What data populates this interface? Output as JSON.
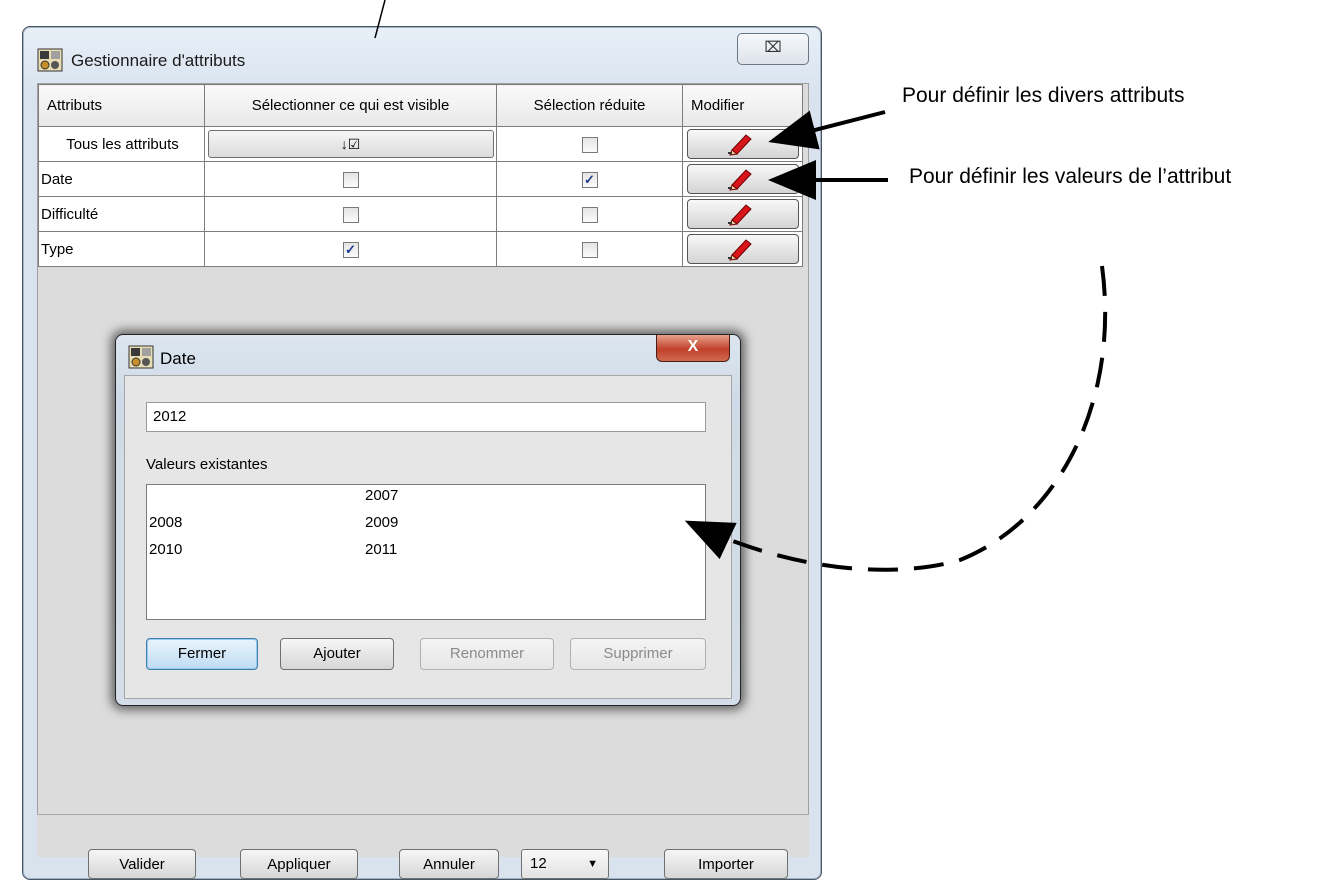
{
  "main_window": {
    "title": "Gestionnaire d'attributs",
    "close_symbol": "⌧",
    "columns": [
      "Attributs",
      "Sélectionner ce qui est visible",
      "Sélection réduite",
      "Modifier"
    ],
    "all_row": {
      "label": "Tous les attributs",
      "visible_button": "↓☑",
      "reduced": false
    },
    "rows": [
      {
        "name": "Date",
        "visible": false,
        "reduced": true
      },
      {
        "name": "Difficulté",
        "visible": false,
        "reduced": false
      },
      {
        "name": "Type",
        "visible": true,
        "reduced": false
      }
    ],
    "buttons": {
      "valider": "Valider",
      "appliquer": "Appliquer",
      "annuler": "Annuler",
      "combo_value": "12",
      "importer": "Importer"
    }
  },
  "date_dialog": {
    "title": "Date",
    "close_symbol": "X",
    "input_value": "2012",
    "existing_label": "Valeurs existantes",
    "values": [
      [
        "",
        "2007"
      ],
      [
        "2008",
        "2009"
      ],
      [
        "2010",
        "2011"
      ]
    ],
    "buttons": {
      "fermer": "Fermer",
      "ajouter": "Ajouter",
      "renommer": "Renommer",
      "supprimer": "Supprimer"
    }
  },
  "annotations": {
    "attrs_note": "Pour définir les divers attributs",
    "values_note": "Pour définir les valeurs de l’attribut"
  },
  "icons": {
    "app": "app-icon",
    "edit": "pencil-icon",
    "dropdown": "chevron-down-icon"
  }
}
